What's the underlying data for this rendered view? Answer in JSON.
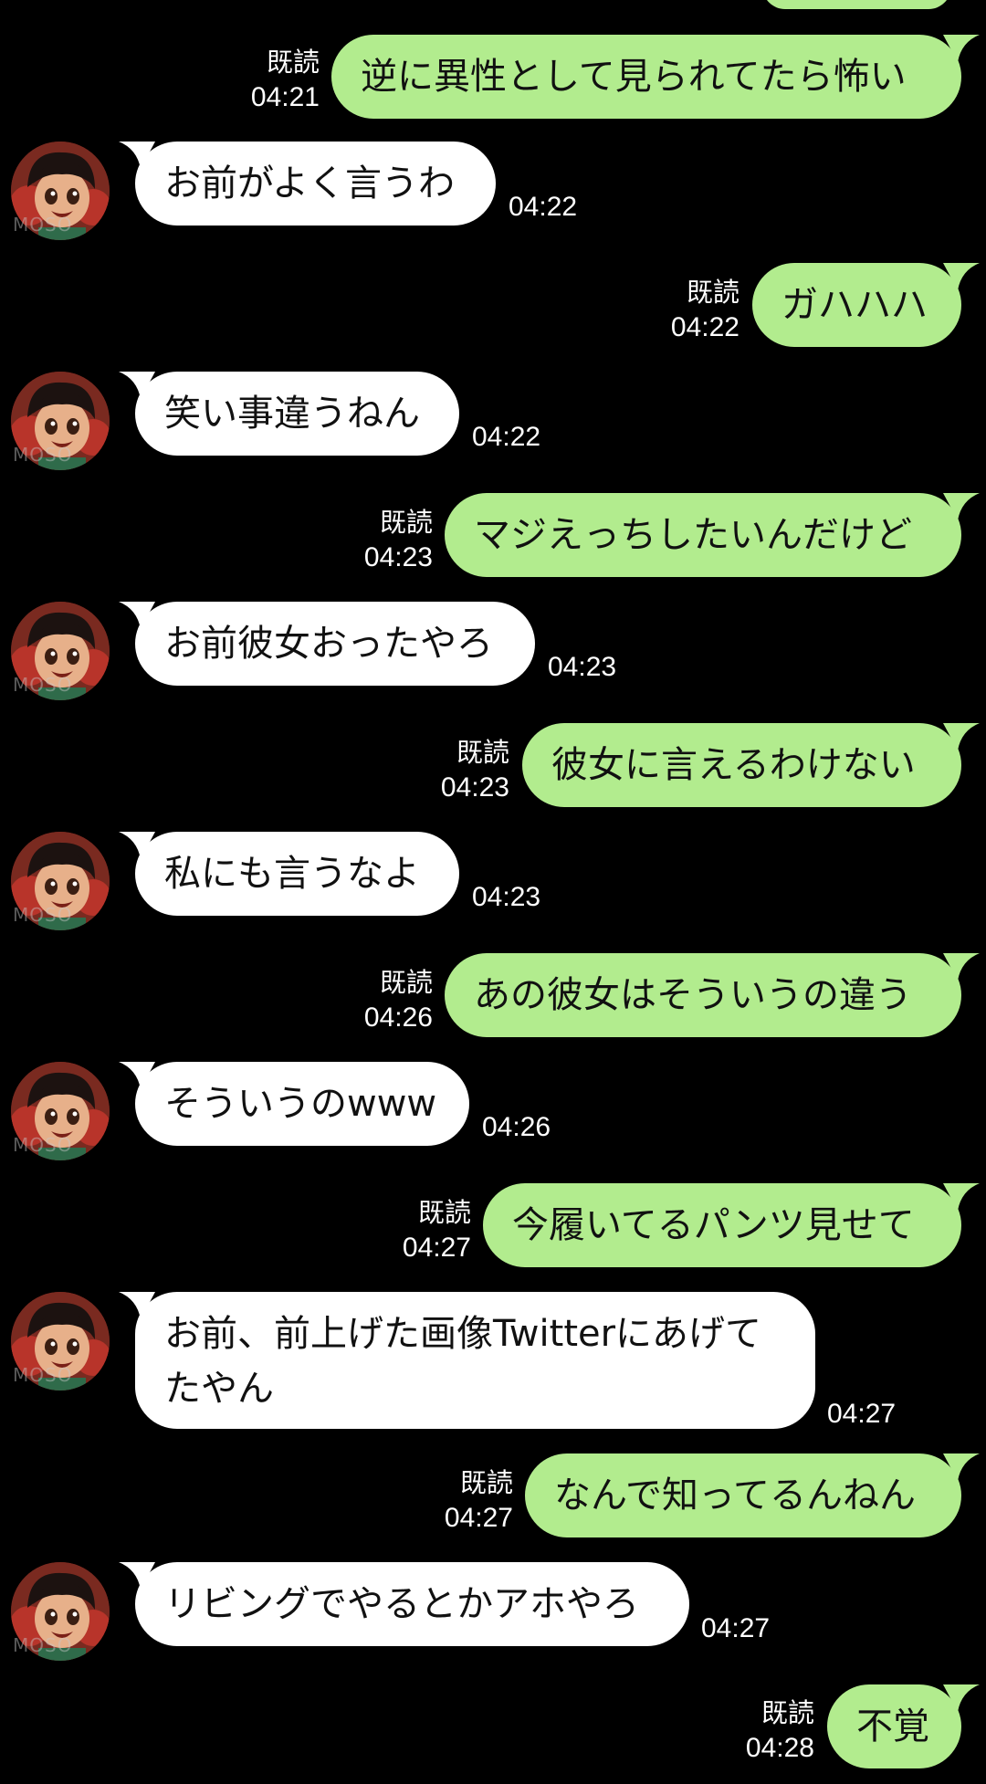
{
  "watermark": "MOSO",
  "read_label": "既読",
  "messages": [
    {
      "side": "out",
      "text": "",
      "time": ""
    },
    {
      "side": "out",
      "text": "逆に異性として見られてたら怖い",
      "time": "04:21",
      "read": true
    },
    {
      "side": "in",
      "text": "お前がよく言うわ",
      "time": "04:22"
    },
    {
      "side": "out",
      "text": "ガハハハ",
      "time": "04:22",
      "read": true
    },
    {
      "side": "in",
      "text": "笑い事違うねん",
      "time": "04:22"
    },
    {
      "side": "out",
      "text": "マジえっちしたいんだけど",
      "time": "04:23",
      "read": true
    },
    {
      "side": "in",
      "text": "お前彼女おったやろ",
      "time": "04:23"
    },
    {
      "side": "out",
      "text": "彼女に言えるわけない",
      "time": "04:23",
      "read": true
    },
    {
      "side": "in",
      "text": "私にも言うなよ",
      "time": "04:23"
    },
    {
      "side": "out",
      "text": "あの彼女はそういうの違う",
      "time": "04:26",
      "read": true
    },
    {
      "side": "in",
      "text": "そういうのwww",
      "time": "04:26"
    },
    {
      "side": "out",
      "text": "今履いてるパンツ見せて",
      "time": "04:27",
      "read": true
    },
    {
      "side": "in",
      "text": "お前、前上げた画像Twitterにあげてたやん",
      "time": "04:27"
    },
    {
      "side": "out",
      "text": "なんで知ってるんねん",
      "time": "04:27",
      "read": true
    },
    {
      "side": "in",
      "text": "リビングでやるとかアホやろ",
      "time": "04:27"
    },
    {
      "side": "out",
      "text": "不覚",
      "time": "04:28",
      "read": true
    }
  ]
}
